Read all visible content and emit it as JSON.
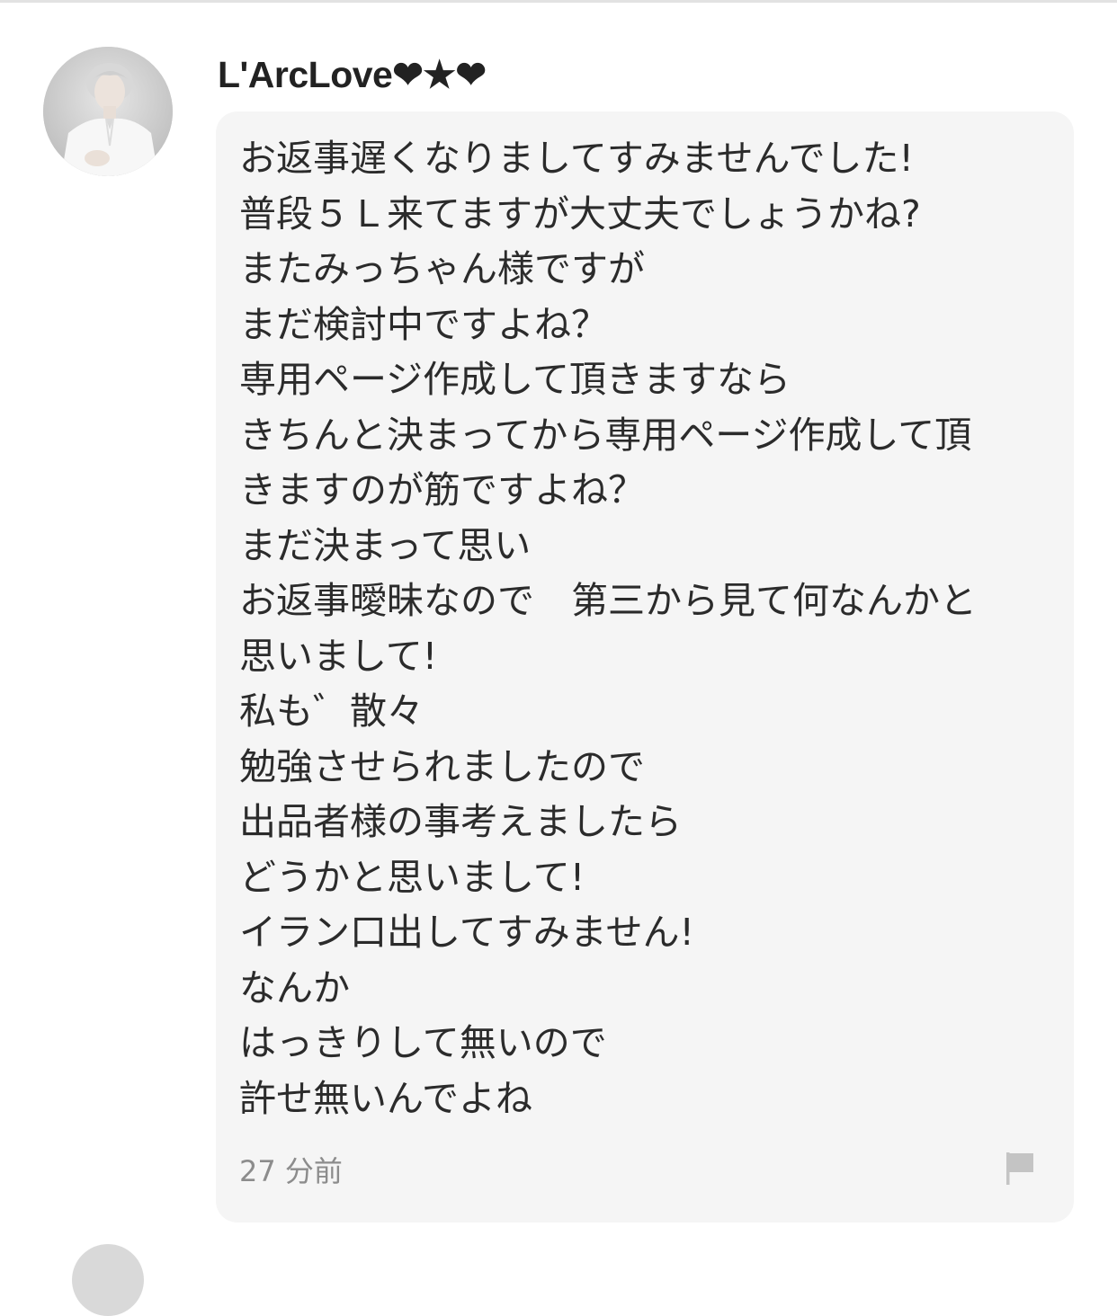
{
  "comment": {
    "username": "L'ArcLove❤︎★❤︎",
    "message_lines": [
      "お返事遅くなりましてすみませんでした!",
      "普段５Ｌ来てますが大丈夫でしょうかね?",
      "またみっちゃん様ですが",
      "まだ検討中ですよね？",
      "専用ページ作成して頂きますなら",
      "きちんと決まってから専用ページ作成して頂",
      "きますのが筋ですよね？",
      "まだ決まって思い",
      "お返事曖昧なので　第三から見て何なんかと",
      "思いまして!",
      "私も゛散々",
      "勉強させられましたので",
      "出品者様の事考えましたら",
      "どうかと思いまして!",
      "イラン口出してすみません!",
      "なんか",
      "はっきりして無いので",
      "許せ無いんでよね"
    ],
    "timestamp": "27 分前",
    "avatar_icon": "user-photo-icon",
    "report_icon": "flag-icon"
  },
  "colors": {
    "bubble_background": "#f5f5f5",
    "text": "#2b2b2b",
    "timestamp": "#8c8c8c",
    "flag": "#c4c4c4"
  }
}
